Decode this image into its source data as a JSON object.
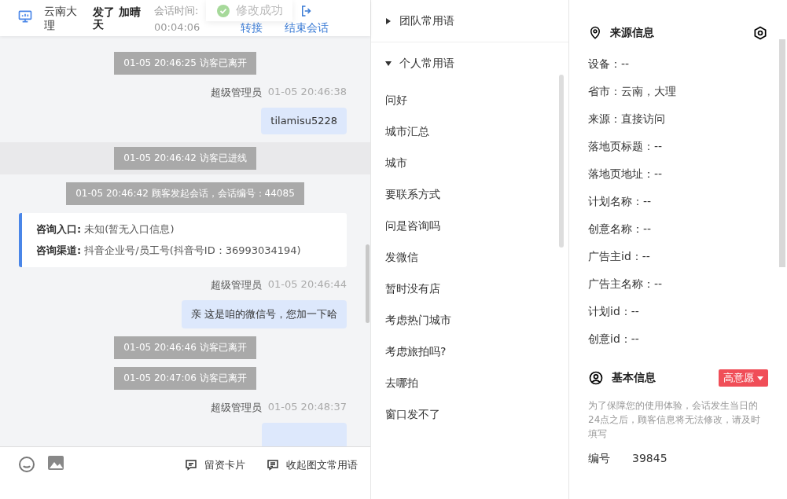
{
  "header": {
    "location": "云南大理",
    "visitor": "发了 加晴天",
    "duration_label": "会话时间:",
    "duration": "00:04:06",
    "actions": [
      "转接",
      "结束会话"
    ],
    "toast": "修改成功"
  },
  "messages": [
    {
      "kind": "system",
      "text": "01-05 20:46:25 访客已离开",
      "highlighted": false
    },
    {
      "kind": "sender",
      "name": "超级管理员",
      "time": "01-05 20:46:38"
    },
    {
      "kind": "bubble",
      "text": "tilamisu5228"
    },
    {
      "kind": "system",
      "text": "01-05 20:46:42 访客已进线",
      "highlighted": true
    },
    {
      "kind": "system",
      "text": "01-05 20:46:42 顾客发起会话，会话编号：44085",
      "highlighted": false
    },
    {
      "kind": "card",
      "lines": [
        {
          "label": "咨询入口:",
          "value": "未知(暂无入口信息)"
        },
        {
          "label": "咨询渠道:",
          "value": "抖音企业号/员工号(抖音号ID：36993034194)"
        }
      ]
    },
    {
      "kind": "sender",
      "name": "超级管理员",
      "time": "01-05 20:46:44"
    },
    {
      "kind": "bubble",
      "text": "亲 这是咱的微信号，您加一下哈"
    },
    {
      "kind": "system",
      "text": "01-05 20:46:46 访客已离开",
      "highlighted": false
    },
    {
      "kind": "system",
      "text": "01-05 20:47:06 访客已离开",
      "highlighted": false
    },
    {
      "kind": "sender",
      "name": "超级管理员",
      "time": "01-05 20:48:37"
    },
    {
      "kind": "bubble"
    }
  ],
  "composer": {
    "tools": [
      {
        "kind": "card",
        "label": "留资卡片"
      },
      {
        "kind": "phrases",
        "label": "收起图文常用语"
      }
    ]
  },
  "phrases": {
    "groups": [
      {
        "title": "团队常用语",
        "expanded": false
      },
      {
        "title": "个人常用语",
        "expanded": true,
        "items": [
          "问好",
          "城市汇总",
          "城市",
          "要联系方式",
          "问是咨询吗",
          "发微信",
          "暂时没有店",
          "考虑热门城市",
          "考虑旅拍吗?",
          "去哪拍",
          "窗口发不了"
        ]
      }
    ]
  },
  "source": {
    "title": "来源信息",
    "fields": [
      "设备：--",
      "省市：云南，大理",
      "来源：直接访问",
      "落地页标题：--",
      "落地页地址：--",
      "计划名称：--",
      "创意名称：--",
      "广告主id：--",
      "广告主名称：--",
      "计划id：--",
      "创意id：--"
    ]
  },
  "basic": {
    "title": "基本信息",
    "intent": "高意愿",
    "notice": "为了保障您的使用体验，会话发生当日的24点之后，顾客信息将无法修改，请及时填写",
    "fields": [
      {
        "label": "编号",
        "value": "39845"
      }
    ]
  }
}
